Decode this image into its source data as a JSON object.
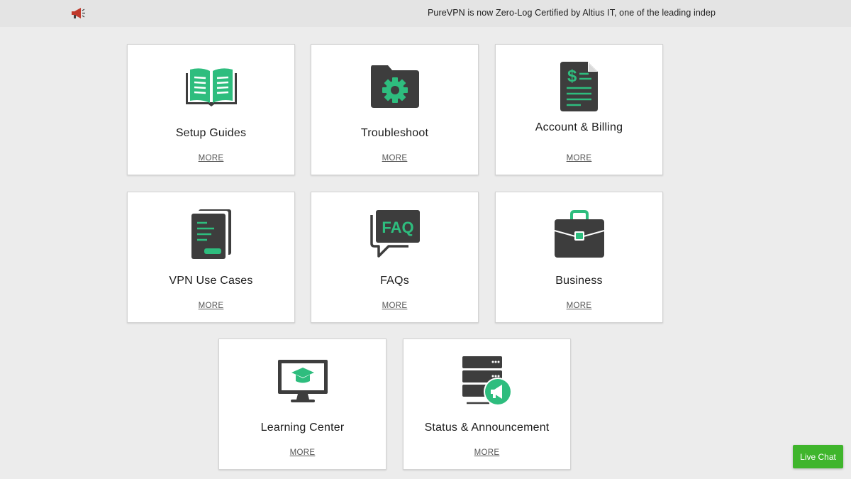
{
  "topbar": {
    "announcement": "PureVPN is now Zero-Log Certified by Altius IT, one of the leading indep",
    "icon": "megaphone-icon"
  },
  "colors": {
    "accent": "#2ebd7e",
    "icon_dark": "#3d3d3d",
    "live_chat": "#3fb52c"
  },
  "cards": [
    {
      "title": "Setup Guides",
      "more": "MORE",
      "icon": "open-book-icon"
    },
    {
      "title": "Troubleshoot",
      "more": "MORE",
      "icon": "folder-gear-icon"
    },
    {
      "title": "Account & Billing",
      "more": "MORE",
      "icon": "billing-document-icon"
    },
    {
      "title": "VPN Use Cases",
      "more": "MORE",
      "icon": "documents-icon"
    },
    {
      "title": "FAQs",
      "more": "MORE",
      "icon": "faq-bubble-icon",
      "icon_text": "FAQ"
    },
    {
      "title": "Business",
      "more": "MORE",
      "icon": "briefcase-icon"
    },
    {
      "title": "Learning Center",
      "more": "MORE",
      "icon": "monitor-graduation-cap-icon"
    },
    {
      "title": "Status & Announcement",
      "more": "MORE",
      "icon": "server-megaphone-icon"
    }
  ],
  "live_chat": {
    "label": "Live Chat"
  }
}
